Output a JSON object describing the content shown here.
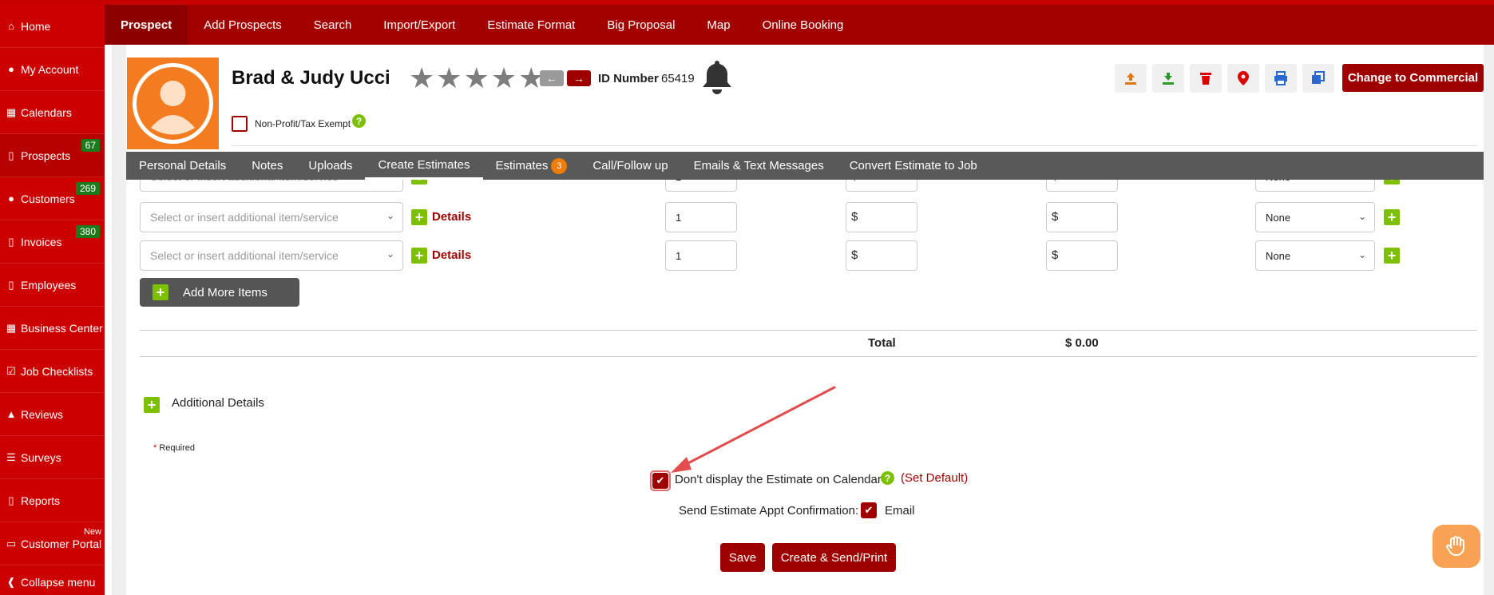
{
  "sidebar": {
    "items": [
      {
        "label": "Home",
        "icon": "home-icon"
      },
      {
        "label": "My Account",
        "icon": "user-icon"
      },
      {
        "label": "Calendars",
        "icon": "calendar-icon"
      },
      {
        "label": "Prospects",
        "icon": "file-icon",
        "badge": "67"
      },
      {
        "label": "Customers",
        "icon": "users-icon",
        "badge": "269"
      },
      {
        "label": "Invoices",
        "icon": "file-icon",
        "badge": "380"
      },
      {
        "label": "Employees",
        "icon": "file-icon"
      },
      {
        "label": "Business Center",
        "icon": "building-icon"
      },
      {
        "label": "Job Checklists",
        "icon": "checkbox-icon"
      },
      {
        "label": "Reviews",
        "icon": "thumbs-up-icon"
      },
      {
        "label": "Surveys",
        "icon": "list-icon"
      },
      {
        "label": "Reports",
        "icon": "file-icon"
      },
      {
        "label": "Customer Portal",
        "icon": "monitor-icon",
        "new": "New"
      },
      {
        "label": "Collapse menu",
        "icon": "arrow-left-circle-icon"
      }
    ]
  },
  "topnav": {
    "tabs": [
      "Prospect",
      "Add Prospects",
      "Search",
      "Import/Export",
      "Estimate Format",
      "Big Proposal",
      "Map",
      "Online Booking"
    ]
  },
  "prospect": {
    "name": "Brad & Judy Ucci",
    "id_label": "ID Number",
    "id_value": "65419",
    "rating_stars": 5,
    "rating_filled": 0,
    "nonprofit_label": "Non-Profit/Tax Exempt"
  },
  "toolbar": {
    "icons": [
      "upload-icon",
      "download-icon",
      "trash-icon",
      "map-pin-icon",
      "print-icon",
      "copy-icon"
    ],
    "commercial_label": "Change to Commercial"
  },
  "subnav": {
    "tabs": [
      "Personal Details",
      "Notes",
      "Uploads",
      "Create Estimates",
      "Estimates",
      "Call/Follow up",
      "Emails & Text Messages",
      "Convert Estimate to Job"
    ],
    "estimates_badge": "3"
  },
  "items": {
    "placeholder": "Select or insert additional item/service",
    "details_label": "Details",
    "qty_value": "1",
    "currency": "$",
    "tax_value": "None",
    "add_more_label": "Add More Items"
  },
  "totals": {
    "label": "Total",
    "value": "$ 0.00"
  },
  "additional": {
    "label": "Additional Details",
    "required_star": "*",
    "required_label": "Required"
  },
  "options": {
    "dont_display_label": "Don't display the Estimate on Calendar",
    "set_default_label": "(Set Default)",
    "send_conf_label": "Send Estimate Appt Confirmation:",
    "email_label": "Email"
  },
  "actions": {
    "save_label": "Save",
    "create_send_label": "Create & Send/Print"
  },
  "colors": {
    "brand_red": "#cc0000",
    "accent_green": "#7cc000",
    "dark_red": "#9e0000"
  }
}
